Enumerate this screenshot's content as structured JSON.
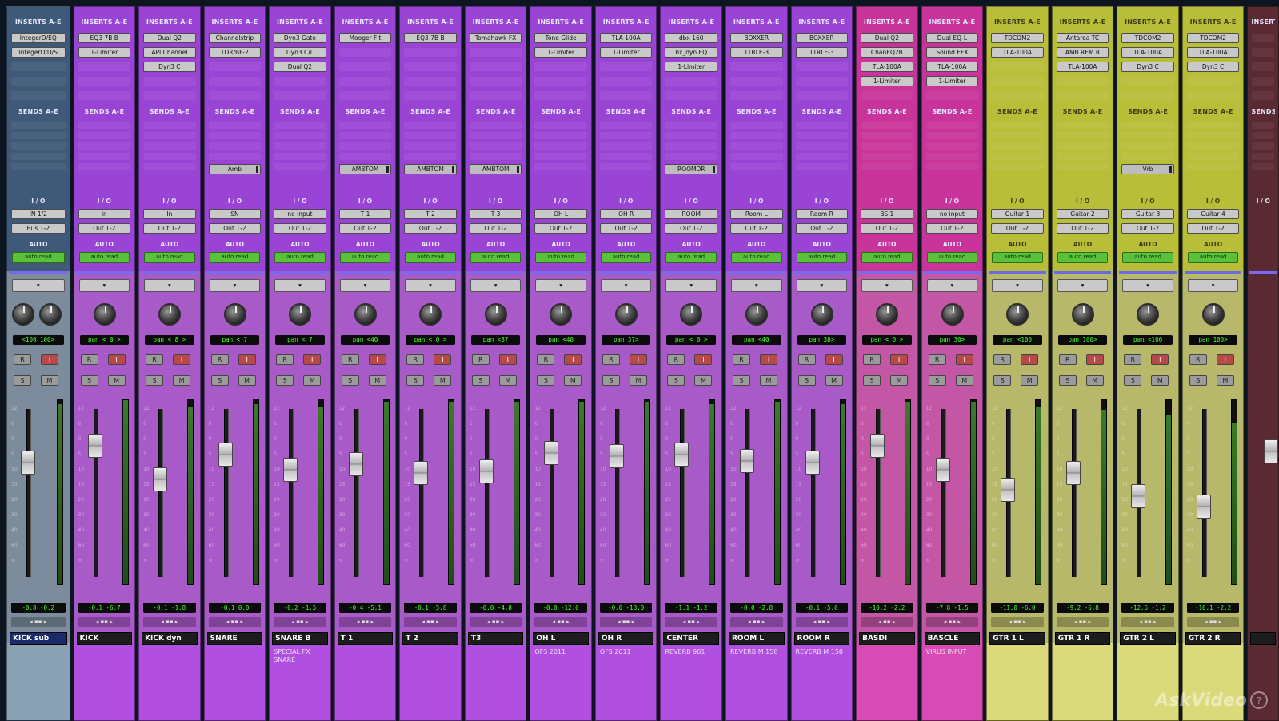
{
  "section_labels": {
    "inserts": "INSERTS A-E",
    "sends": "SENDS A-E",
    "io": "I / O",
    "auto": "AUTO"
  },
  "colors": {
    "blue": "#3f5a78",
    "purple": "#9a44d6",
    "magenta": "#c8349a",
    "yellow": "#b8be38",
    "darkred": "#5a2a33",
    "fader_bg_blue": "#7c8c9d",
    "fader_bg_purple": "#a85ac8",
    "fader_bg_magenta": "#c456a6",
    "fader_bg_yellow": "#b8b86a",
    "comment_blue": "#8aa0b4",
    "comment_purple": "#b14fe0",
    "comment_magenta": "#d84bb5",
    "comment_yellow": "#dada7a"
  },
  "strips": [
    {
      "name": "KICK sub",
      "color": "blue",
      "inserts": [
        "IntegerD/EQ",
        "IntegerD/D/S"
      ],
      "sends": [],
      "input": "IN 1/2",
      "output": "Bus 1-2",
      "auto": "auto read",
      "pan": "<100  100>",
      "pan2": true,
      "vol": "-0.8  -0.2",
      "fader": 0.32,
      "meter": 0.98,
      "comment": "",
      "selected": true
    },
    {
      "name": "KICK",
      "color": "purple",
      "inserts": [
        "EQ3 7B B",
        "1-Limiter"
      ],
      "sends": [],
      "input": "In",
      "output": "Out 1-2",
      "auto": "auto read",
      "pan": "pan  < 0  >",
      "vol": "-0.1  -6.7",
      "fader": 0.22,
      "meter": 1.0,
      "comment": ""
    },
    {
      "name": "KICK dyn",
      "color": "purple",
      "inserts": [
        "Dual Q2",
        "API Channel",
        "Dyn3 C"
      ],
      "sends": [],
      "input": "In",
      "output": "Out 1-2",
      "auto": "auto read",
      "pan": "pan  < 8  >",
      "vol": "-0.1  -1.8",
      "fader": 0.42,
      "meter": 0.96,
      "comment": ""
    },
    {
      "name": "SNARE",
      "color": "purple",
      "inserts": [
        "Channelstrip",
        "TDR/BF-2"
      ],
      "sends": [
        "Amb"
      ],
      "input": "SN",
      "output": "Out 1-2",
      "auto": "auto read",
      "pan": "pan  < 7",
      "vol": "-0.1  0.0",
      "fader": 0.27,
      "meter": 0.98,
      "comment": ""
    },
    {
      "name": "SNARE B",
      "color": "purple",
      "inserts": [
        "Dyn3 Gate",
        "Dyn3 C/L",
        "Dual Q2"
      ],
      "sends": [],
      "input": "no input",
      "output": "Out 1-2",
      "auto": "auto read",
      "pan": "pan  < 7",
      "vol": "-0.2  -1.5",
      "fader": 0.36,
      "meter": 0.96,
      "comment": "SPECIAL FX SNARE"
    },
    {
      "name": "T 1",
      "color": "purple",
      "inserts": [
        "Mooger Flt"
      ],
      "sends": [
        "AMBTOM"
      ],
      "input": "T 1",
      "output": "Out 1-2",
      "auto": "auto read",
      "pan": "pan  <40",
      "vol": "-0.4  -5.1",
      "fader": 0.33,
      "meter": 0.99,
      "comment": ""
    },
    {
      "name": "T 2",
      "color": "purple",
      "inserts": [
        "EQ3 7B B"
      ],
      "sends": [
        "AMBTOM"
      ],
      "input": "T 2",
      "output": "Out 1-2",
      "auto": "auto read",
      "pan": "pan  < 0  >",
      "vol": "-0.1  -5.8",
      "fader": 0.38,
      "meter": 0.99,
      "comment": ""
    },
    {
      "name": "T3",
      "color": "purple",
      "inserts": [
        "Tomahawk FX"
      ],
      "sends": [
        "AMBTOM"
      ],
      "input": "T 3",
      "output": "Out 1-2",
      "auto": "auto read",
      "pan": "pan  <37",
      "vol": "-0.0  -4.8",
      "fader": 0.37,
      "meter": 0.99,
      "comment": ""
    },
    {
      "name": "OH L",
      "color": "purple",
      "inserts": [
        "Tone Glide",
        "1-Limiter"
      ],
      "sends": [],
      "input": "OH L",
      "output": "Out 1-2",
      "auto": "auto read",
      "pan": "pan  <40",
      "vol": "-0.0  -12.0",
      "fader": 0.26,
      "meter": 0.99,
      "comment": "OFS 2011"
    },
    {
      "name": "OH R",
      "color": "purple",
      "inserts": [
        "TLA-100A",
        "1-Limiter"
      ],
      "sends": [],
      "input": "OH R",
      "output": "Out 1-2",
      "auto": "auto read",
      "pan": "pan  37>",
      "vol": "-0.0  -13.0",
      "fader": 0.28,
      "meter": 0.99,
      "comment": "OFS 2011"
    },
    {
      "name": "CENTER",
      "color": "purple",
      "inserts": [
        "dbx 160",
        "bx_dyn EQ",
        "1-Limiter"
      ],
      "sends": [
        "ROOMDR"
      ],
      "input": "ROOM",
      "output": "Out 1-2",
      "auto": "auto read",
      "pan": "pan  < 0  >",
      "vol": "-1.1  -1.2",
      "fader": 0.27,
      "meter": 0.98,
      "comment": "REVERB 901"
    },
    {
      "name": "ROOM L",
      "color": "purple",
      "inserts": [
        "BOXXER",
        "TTRLE-3"
      ],
      "sends": [],
      "input": "Room L",
      "output": "Out 1-2",
      "auto": "auto read",
      "pan": "pan  <40",
      "vol": "-0.0  -2.8",
      "fader": 0.31,
      "meter": 0.99,
      "comment": "REVERB M 158"
    },
    {
      "name": "ROOM R",
      "color": "purple",
      "inserts": [
        "BOXXER",
        "TTRLE-3"
      ],
      "sends": [],
      "input": "Room R",
      "output": "Out 1-2",
      "auto": "auto read",
      "pan": "pan  38>",
      "vol": "-0.1  -5.0",
      "fader": 0.32,
      "meter": 0.98,
      "comment": "REVERB M 158"
    },
    {
      "name": "BASDI",
      "color": "magenta",
      "inserts": [
        "Dual Q2",
        "ChanEQ2B",
        "TLA-100A",
        "1-Limiter"
      ],
      "sends": [],
      "input": "BS 1",
      "output": "Out 1-2",
      "auto": "auto read",
      "pan": "pan  < 0  >",
      "vol": "-10.2  -2.2",
      "fader": 0.22,
      "meter": 0.99,
      "comment": ""
    },
    {
      "name": "BASCLE",
      "color": "magenta",
      "inserts": [
        "Dual EQ-L",
        "Sound EFX",
        "TLA-100A",
        "1-Limiter"
      ],
      "sends": [],
      "input": "no input",
      "output": "Out 1-2",
      "auto": "auto read",
      "pan": "pan  30>",
      "vol": "-7.8  -1.5",
      "fader": 0.36,
      "meter": 0.99,
      "comment": "VIRUS INPUT"
    },
    {
      "name": "GTR 1 L",
      "color": "yellow",
      "inserts": [
        "TDCOM2",
        "TLA-100A"
      ],
      "sends": [],
      "input": "Guitar 1",
      "output": "Out 1-2",
      "auto": "auto read",
      "pan": "pan  <100",
      "vol": "-11.0  -6.0",
      "fader": 0.48,
      "meter": 0.96,
      "comment": ""
    },
    {
      "name": "GTR 1 R",
      "color": "yellow",
      "inserts": [
        "Antarea TC",
        "AMB REM R",
        "TLA-100A"
      ],
      "sends": [],
      "input": "Guitar 2",
      "output": "Out 1-2",
      "auto": "auto read",
      "pan": "pan  100>",
      "vol": "-9.2  -6.8",
      "fader": 0.38,
      "meter": 0.95,
      "comment": ""
    },
    {
      "name": "GTR 2 L",
      "color": "yellow",
      "inserts": [
        "TDCOM2",
        "TLA-100A",
        "Dyn3 C"
      ],
      "sends": [
        "Vrb"
      ],
      "input": "Guitar 3",
      "output": "Out 1-2",
      "auto": "auto read",
      "pan": "pan  <100",
      "vol": "-12.6  -1.2",
      "fader": 0.52,
      "meter": 0.92,
      "comment": ""
    },
    {
      "name": "GTR 2 R",
      "color": "yellow",
      "inserts": [
        "TDCOM2",
        "TLA-100A",
        "Dyn3 C"
      ],
      "sends": [],
      "input": "Guitar 4",
      "output": "Out 1-2",
      "auto": "auto read",
      "pan": "pan  100>",
      "vol": "-10.1  -2.2",
      "fader": 0.58,
      "meter": 0.88,
      "comment": ""
    },
    {
      "name": "",
      "color": "darkred",
      "inserts": [],
      "sends": [],
      "input": "",
      "output": "",
      "auto": "",
      "pan": "",
      "vol": "",
      "fader": 0.25,
      "meter": 0.0,
      "comment": "",
      "partial": true
    }
  ],
  "watermark": "AskVideo",
  "watermark_mark": "?"
}
